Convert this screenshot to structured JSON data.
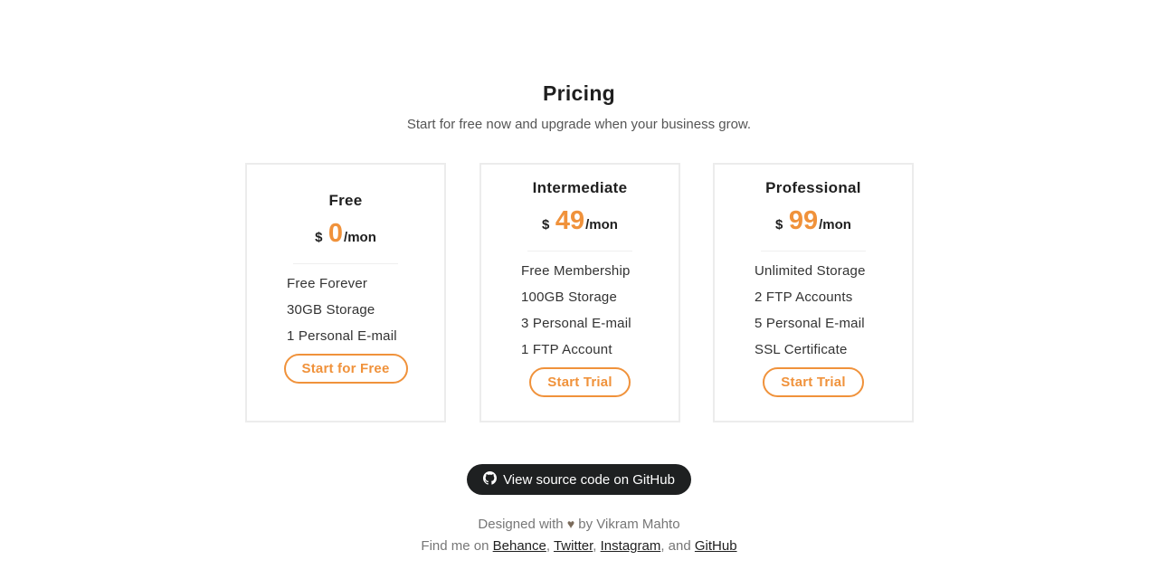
{
  "header": {
    "title": "Pricing",
    "subtitle": "Start for free now and upgrade when your business grow."
  },
  "accent_color": "#f0923b",
  "plans": [
    {
      "name": "Free",
      "currency": "$",
      "amount": "0",
      "period": "/mon",
      "features": [
        "Free Forever",
        "30GB Storage",
        "1 Personal E-mail"
      ],
      "cta": "Start for Free"
    },
    {
      "name": "Intermediate",
      "currency": "$",
      "amount": "49",
      "period": "/mon",
      "features": [
        "Free Membership",
        "100GB Storage",
        "3 Personal E-mail",
        "1 FTP Account"
      ],
      "cta": "Start Trial"
    },
    {
      "name": "Professional",
      "currency": "$",
      "amount": "99",
      "period": "/mon",
      "features": [
        "Unlimited Storage",
        "2 FTP Accounts",
        "5 Personal E-mail",
        "SSL Certificate"
      ],
      "cta": "Start Trial"
    }
  ],
  "github_button": {
    "label": "View source code on GitHub",
    "icon": "github-icon"
  },
  "footer": {
    "designed_prefix": "Designed with",
    "heart": "♥",
    "designed_suffix": "by Vikram Mahto",
    "find_prefix": "Find me on",
    "links": [
      "Behance",
      "Twitter",
      "Instagram",
      "GitHub"
    ],
    "sep1": ",",
    "sep2": ",",
    "sep3": ", and"
  }
}
